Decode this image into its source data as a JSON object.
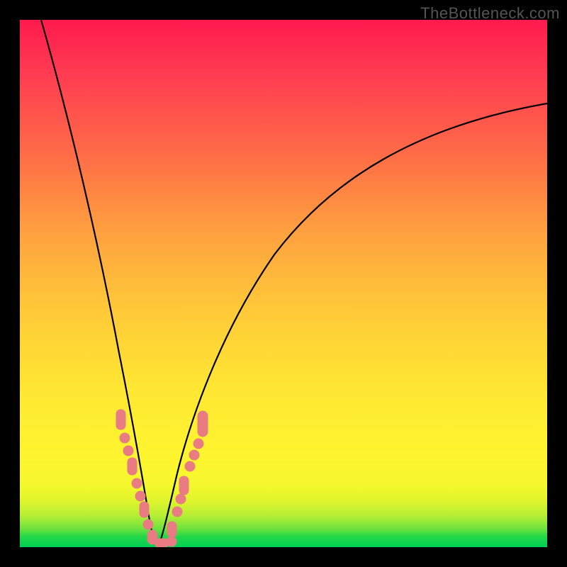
{
  "watermark": "TheBottleneck.com",
  "colors": {
    "frame": "#000000",
    "gradient_top": "#ff1a4d",
    "gradient_mid": "#ffe733",
    "gradient_bottom": "#00cf55",
    "curve": "#000000",
    "bead": "#e97b82"
  },
  "chart_data": {
    "type": "line",
    "title": "",
    "xlabel": "",
    "ylabel": "",
    "xlim": [
      0,
      100
    ],
    "ylim": [
      0,
      100
    ],
    "series": [
      {
        "name": "left-curve",
        "x": [
          4,
          6,
          8,
          10,
          12,
          14,
          16,
          18,
          20,
          21,
          22,
          23,
          24,
          25
        ],
        "y": [
          100,
          92,
          83,
          73,
          62,
          50,
          37,
          25,
          14,
          9,
          6,
          3,
          1,
          0
        ]
      },
      {
        "name": "right-curve",
        "x": [
          25,
          26,
          27,
          28,
          29,
          30,
          32,
          35,
          40,
          48,
          58,
          70,
          83,
          100
        ],
        "y": [
          0,
          2,
          5,
          8,
          12,
          16,
          23,
          32,
          44,
          56,
          66,
          74,
          80,
          85
        ]
      }
    ],
    "markers": [
      {
        "series": "left-curve",
        "x": 19.0,
        "y": 20
      },
      {
        "series": "left-curve",
        "x": 19.8,
        "y": 16
      },
      {
        "series": "left-curve",
        "x": 20.6,
        "y": 12
      },
      {
        "series": "left-curve",
        "x": 21.4,
        "y": 9
      },
      {
        "series": "left-curve",
        "x": 22.2,
        "y": 6
      },
      {
        "series": "left-curve",
        "x": 23.0,
        "y": 3.5
      },
      {
        "series": "left-curve",
        "x": 23.8,
        "y": 1.5
      },
      {
        "series": "left-curve",
        "x": 24.6,
        "y": 0.5
      },
      {
        "series": "right-curve",
        "x": 25.4,
        "y": 0.5
      },
      {
        "series": "right-curve",
        "x": 26.2,
        "y": 2
      },
      {
        "series": "right-curve",
        "x": 27.0,
        "y": 4
      },
      {
        "series": "right-curve",
        "x": 27.8,
        "y": 7
      },
      {
        "series": "right-curve",
        "x": 28.6,
        "y": 10
      },
      {
        "series": "right-curve",
        "x": 29.4,
        "y": 13
      },
      {
        "series": "right-curve",
        "x": 30.2,
        "y": 16
      },
      {
        "series": "right-curve",
        "x": 31.0,
        "y": 19
      },
      {
        "series": "right-curve",
        "x": 31.8,
        "y": 22
      }
    ]
  }
}
